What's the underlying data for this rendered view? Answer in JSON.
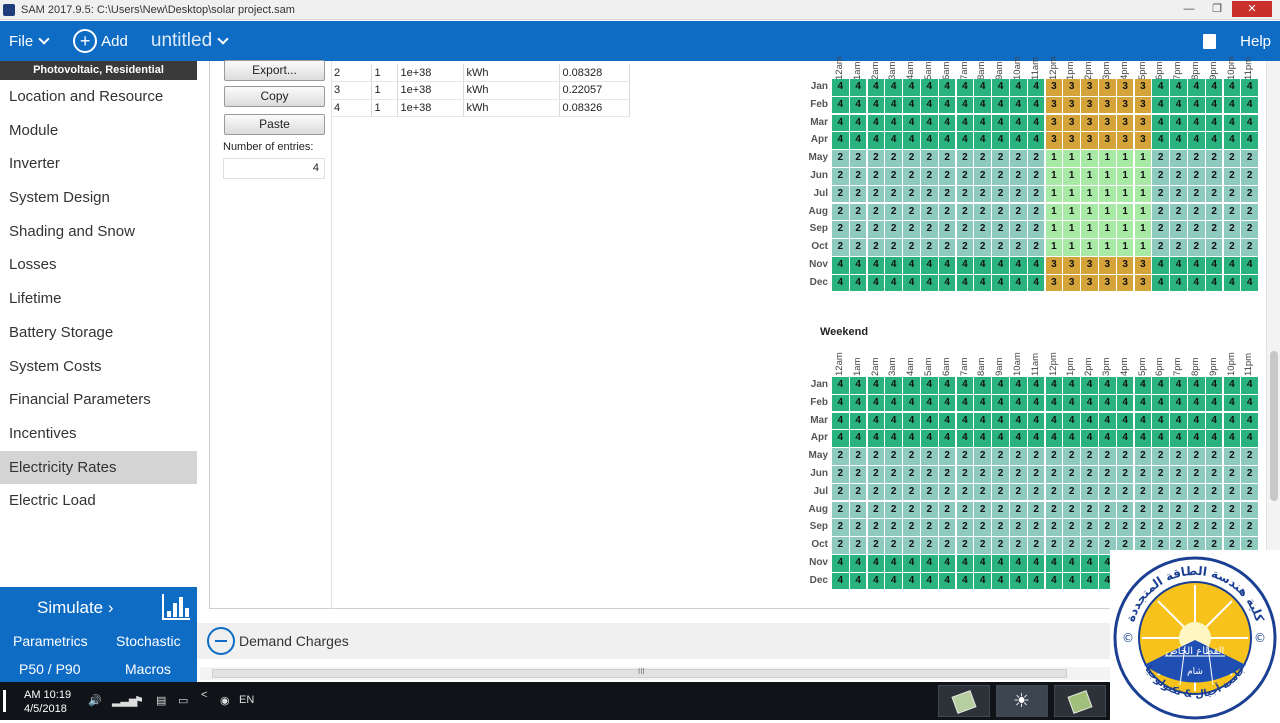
{
  "window": {
    "title": "SAM 2017.9.5: C:\\Users\\New\\Desktop\\solar project.sam",
    "minimize": "—",
    "maximize": "❐",
    "close": "✕"
  },
  "topbar": {
    "file": "File",
    "add": "Add",
    "case_name": "untitled",
    "help": "Help"
  },
  "sidebar": {
    "header": "Photovoltaic, Residential",
    "items": [
      "Location and Resource",
      "Module",
      "Inverter",
      "System Design",
      "Shading and Snow",
      "Losses",
      "Lifetime",
      "Battery Storage",
      "System Costs",
      "Financial Parameters",
      "Incentives",
      "Electricity Rates",
      "Electric Load"
    ],
    "selected_index": 11
  },
  "sim_panel": {
    "simulate": "Simulate",
    "parametrics": "Parametrics",
    "stochastic": "Stochastic",
    "p50": "P50 / P90",
    "macros": "Macros"
  },
  "rates": {
    "export_btn": "Export...",
    "copy_btn": "Copy",
    "paste_btn": "Paste",
    "num_entries_label": "Number of entries:",
    "num_entries": "4",
    "rows": [
      [
        "2",
        "1",
        "1e+38",
        "kWh",
        "0.08328"
      ],
      [
        "3",
        "1",
        "1e+38",
        "kWh",
        "0.22057"
      ],
      [
        "4",
        "1",
        "1e+38",
        "kWh",
        "0.08326"
      ]
    ]
  },
  "schedule": {
    "months": [
      "Jan",
      "Feb",
      "Mar",
      "Apr",
      "May",
      "Jun",
      "Jul",
      "Aug",
      "Sep",
      "Oct",
      "Nov",
      "Dec"
    ],
    "hours": [
      "12am",
      "1am",
      "2am",
      "3am",
      "4am",
      "5am",
      "6am",
      "7am",
      "8am",
      "9am",
      "10am",
      "11am",
      "12pm",
      "1pm",
      "2pm",
      "3pm",
      "4pm",
      "5pm",
      "6pm",
      "7pm",
      "8pm",
      "9pm",
      "10pm",
      "11pm"
    ],
    "weekday_period_by_month": {
      "Jan": "444444444444333333444444",
      "Feb": "444444444444333333444444",
      "Mar": "444444444444333333444444",
      "Apr": "444444444444333333444444",
      "May": "222222222222111111222222",
      "Jun": "222222222222111111222222",
      "Jul": "222222222222111111222222",
      "Aug": "222222222222111111222222",
      "Sep": "222222222222111111222222",
      "Oct": "222222222222111111222222",
      "Nov": "444444444444333333444444",
      "Dec": "444444444444333333444444"
    },
    "weekend_label": "Weekend",
    "weekend_period_by_month": {
      "Jan": "444444444444444444444444",
      "Feb": "444444444444444444444444",
      "Mar": "444444444444444444444444",
      "Apr": "444444444444444444444444",
      "May": "222222222222222222222222",
      "Jun": "222222222222222222222222",
      "Jul": "222222222222222222222222",
      "Aug": "222222222222222222222222",
      "Sep": "222222222222222222222222",
      "Oct": "222222222222222222222222",
      "Nov": "444444444444444444444444",
      "Dec": "444444444444444444444444"
    },
    "colors": {
      "1": "#a8e9a6",
      "2": "#8fcabf",
      "3": "#d4a43a",
      "4": "#2ab37f"
    }
  },
  "bottom": {
    "demand_charges": "Demand Charges",
    "hscroll_grip": "III"
  },
  "taskbar": {
    "time": "AM 10:19",
    "date": "4/5/2018",
    "lang": "EN"
  },
  "logo": {
    "arabic_top": "كلية هندسة الطاقة المتجددة",
    "arabic_mid": "القطاع الخاص",
    "arabic_bottom": "جامعة أجيال & تكنولوجيا",
    "arabic_small": "شام"
  }
}
